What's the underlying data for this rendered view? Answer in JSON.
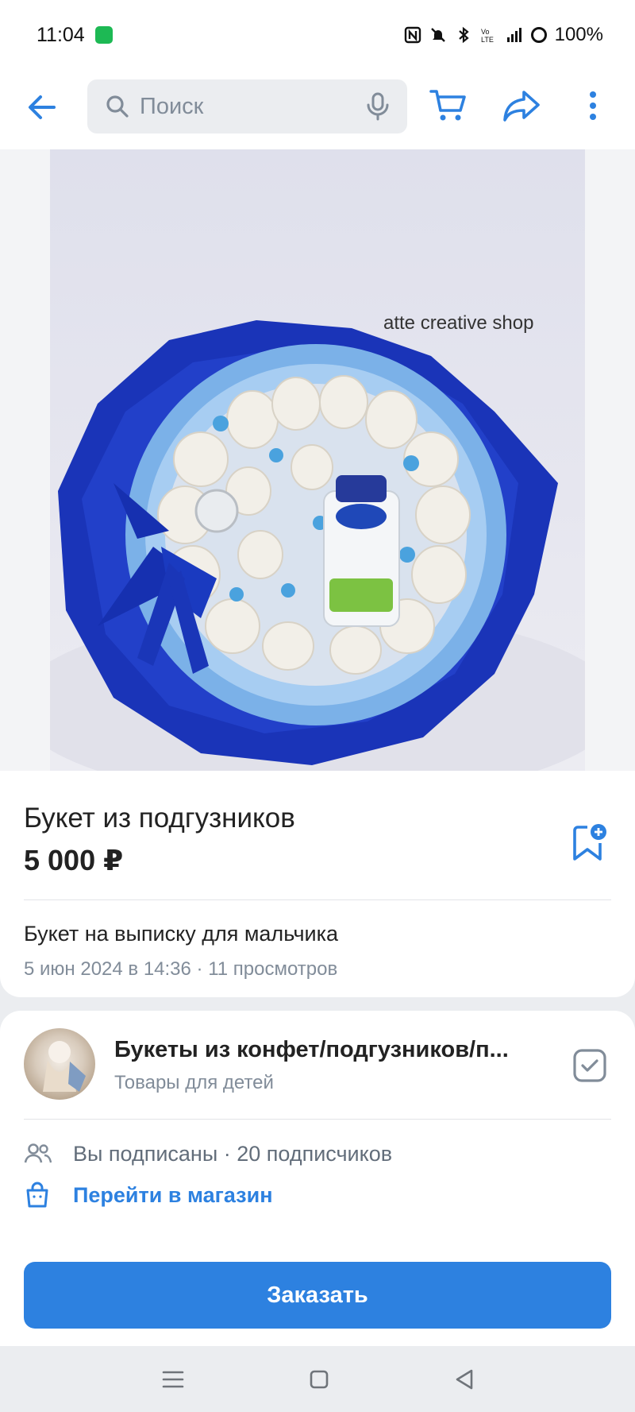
{
  "status_bar": {
    "time": "11:04",
    "battery": "100%"
  },
  "toolbar": {
    "search_placeholder": "Поиск"
  },
  "photo": {
    "watermark": "atte creative shop"
  },
  "product": {
    "title": "Букет из подгузников",
    "price": "5 000 ₽",
    "description": "Букет на выписку для мальчика",
    "meta": "5 июн 2024 в 14:36 · 11 просмотров"
  },
  "shop": {
    "name": "Букеты из конфет/подгузников/п...",
    "category": "Товары для детей",
    "subscribers": "Вы подписаны · 20 подписчиков",
    "goto": "Перейти в магазин"
  },
  "order": {
    "label": "Заказать"
  },
  "colors": {
    "accent": "#2d81e0",
    "secondary_text": "#818c99"
  },
  "icons": [
    "back-arrow-icon",
    "search-icon",
    "mic-icon",
    "cart-icon",
    "share-icon",
    "more-icon",
    "bookmark-add-icon",
    "checkbox-icon",
    "users-icon",
    "shop-bag-icon",
    "menu-icon",
    "home-icon",
    "back-nav-icon"
  ]
}
